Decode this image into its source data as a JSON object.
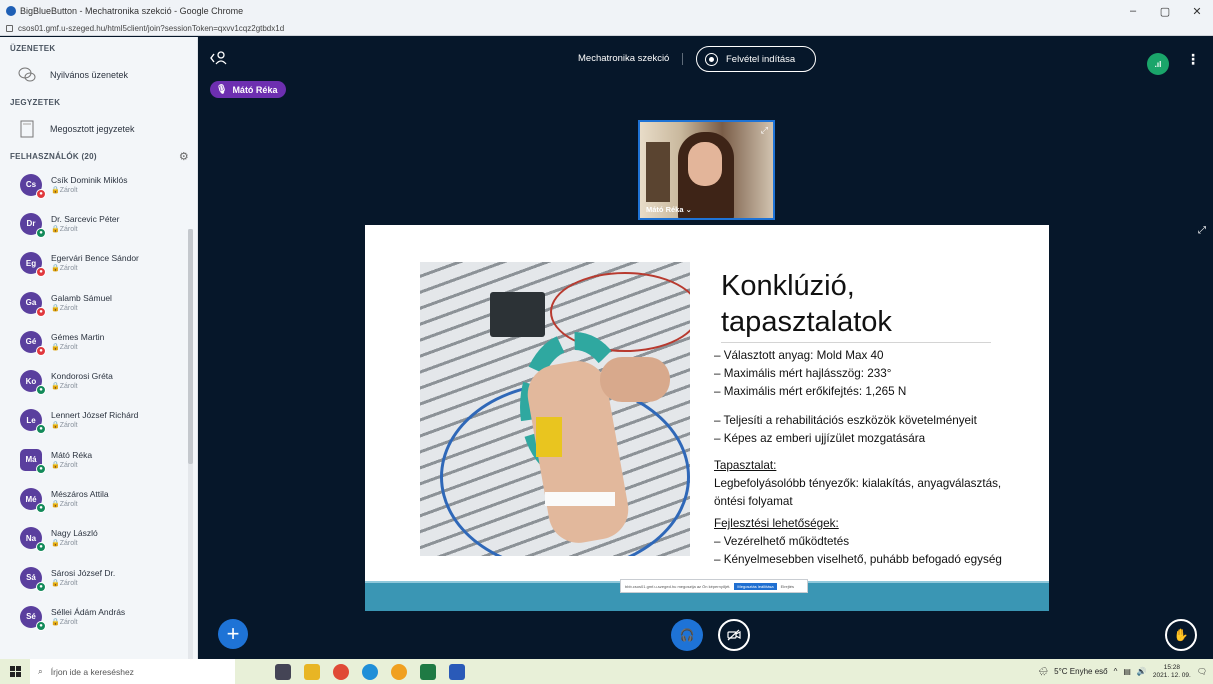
{
  "browser": {
    "title": "BigBlueButton - Mechatronika szekció - Google Chrome",
    "url": "csos01.gmf.u-szeged.hu/html5client/join?sessionToken=qxvv1cqz2gtbdx1d",
    "controls": [
      "–",
      "▢",
      "✕"
    ]
  },
  "sidebar": {
    "messages_heading": "ÜZENETEK",
    "public_chat": "Nyilvános üzenetek",
    "notes_heading": "JEGYZETEK",
    "shared_notes": "Megosztott jegyzetek",
    "users_heading": "FELHASZNÁLÓK (20)",
    "users": [
      {
        "initials": "Cs",
        "name": "Csík Dominik Miklós",
        "status": "Zárolt",
        "mic": "red"
      },
      {
        "initials": "Dr",
        "name": "Dr. Sarcevic Péter",
        "status": "Zárolt",
        "mic": "green"
      },
      {
        "initials": "Eg",
        "name": "Egervári Bence Sándor",
        "status": "Zárolt",
        "mic": "red"
      },
      {
        "initials": "Ga",
        "name": "Galamb Sámuel",
        "status": "Zárolt",
        "mic": "red"
      },
      {
        "initials": "Gé",
        "name": "Gémes Martin",
        "status": "Zárolt",
        "mic": "red"
      },
      {
        "initials": "Ko",
        "name": "Kondorosi Gréta",
        "status": "Zárolt",
        "mic": "green"
      },
      {
        "initials": "Le",
        "name": "Lennert József Richárd",
        "status": "Zárolt",
        "mic": "green"
      },
      {
        "initials": "Má",
        "name": "Mátó Réka",
        "status": "Zárolt",
        "mic": "green"
      },
      {
        "initials": "Mé",
        "name": "Mészáros Attila",
        "status": "Zárolt",
        "mic": "green"
      },
      {
        "initials": "Na",
        "name": "Nagy László",
        "status": "Zárolt",
        "mic": "green"
      },
      {
        "initials": "Sá",
        "name": "Sárosi József Dr.",
        "status": "Zárolt",
        "mic": "green"
      },
      {
        "initials": "Sé",
        "name": "Séllei Ádám András",
        "status": "Zárolt",
        "mic": "green"
      }
    ]
  },
  "topbar": {
    "speaker": "Mátó Réka",
    "meeting_title": "Mechatronika szekció",
    "record_label": "Felvétel indítása"
  },
  "webcam": {
    "label": "Mátó Réka ⌄"
  },
  "slide": {
    "title_line1": "Konklúzió,",
    "title_line2": "tapasztalatok",
    "bullets1": [
      "– Választott anyag: Mold Max 40",
      "– Maximális mért hajlásszög: 233°",
      "– Maximális mért erőkifejtés: 1,265 N"
    ],
    "bullets2": [
      "– Teljesíti a rehabilitációs eszközök követelményeit",
      "– Képes az emberi ujjízület mozgatására"
    ],
    "experience_heading": "Tapasztalat:",
    "experience_text1": "Legbefolyásolóbb tényezők: kialakítás, anyagválasztás,",
    "experience_text2": "öntési folyamat",
    "dev_heading": "Fejlesztési lehetőségek:",
    "dev_items": [
      "– Vezérelhető működtetés",
      "– Kényelmesebben viselhető, puhább befogadó egység"
    ],
    "notice_text": "bbb.csos01.gmf.u-szeged.hu megosztja az Ön képernyőjét.",
    "notice_stop": "Megosztás leállítása",
    "notice_hide": "Elrejtés"
  },
  "taskbar": {
    "search_placeholder": "Írjon ide a kereséshez",
    "weather": "5°C Enyhe eső",
    "time": "15:28",
    "date": "2021. 12. 09."
  },
  "colors": {
    "accent": "#1e73d6",
    "main_bg": "#06172A",
    "speaker_bg": "#6d2fb0",
    "connection": "#1aa56a",
    "slide_footer": "#3a96b4"
  }
}
